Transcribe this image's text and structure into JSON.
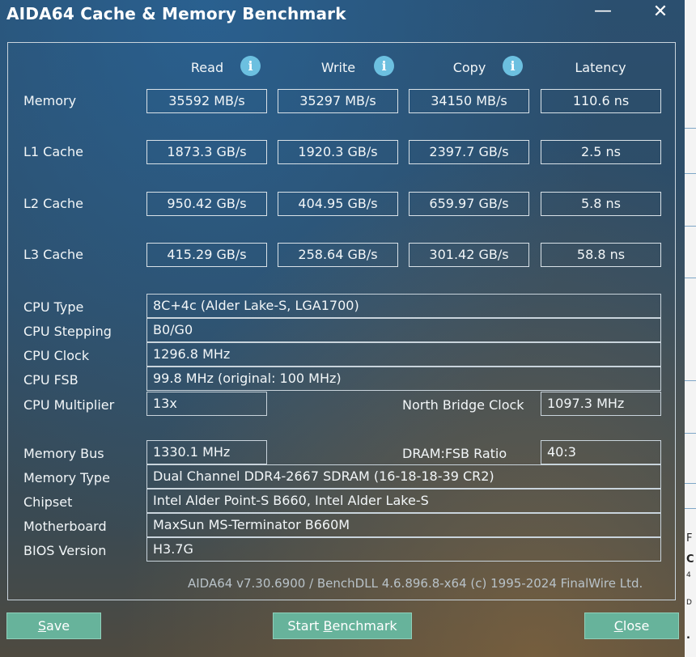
{
  "window": {
    "title": "AIDA64 Cache & Memory Benchmark",
    "minimize_glyph": "—",
    "close_glyph": "✕"
  },
  "columns": {
    "read": "Read",
    "write": "Write",
    "copy": "Copy",
    "latency": "Latency",
    "info_glyph": "i"
  },
  "bench_rows": [
    {
      "label": "Memory",
      "read": "35592 MB/s",
      "write": "35297 MB/s",
      "copy": "34150 MB/s",
      "latency": "110.6 ns"
    },
    {
      "label": "L1 Cache",
      "read": "1873.3 GB/s",
      "write": "1920.3 GB/s",
      "copy": "2397.7 GB/s",
      "latency": "2.5 ns"
    },
    {
      "label": "L2 Cache",
      "read": "950.42 GB/s",
      "write": "404.95 GB/s",
      "copy": "659.97 GB/s",
      "latency": "5.8 ns"
    },
    {
      "label": "L3 Cache",
      "read": "415.29 GB/s",
      "write": "258.64 GB/s",
      "copy": "301.42 GB/s",
      "latency": "58.8 ns"
    }
  ],
  "cpu": {
    "type_label": "CPU Type",
    "type_value": "8C+4c   (Alder Lake-S, LGA1700)",
    "stepping_label": "CPU Stepping",
    "stepping_value": "B0/G0",
    "clock_label": "CPU Clock",
    "clock_value": "1296.8 MHz",
    "fsb_label": "CPU FSB",
    "fsb_value": "99.8 MHz  (original: 100 MHz)",
    "multiplier_label": "CPU Multiplier",
    "multiplier_value": "13x",
    "nb_clock_label": "North Bridge Clock",
    "nb_clock_value": "1097.3 MHz"
  },
  "memory": {
    "bus_label": "Memory Bus",
    "bus_value": "1330.1 MHz",
    "ratio_label": "DRAM:FSB Ratio",
    "ratio_value": "40:3",
    "type_label": "Memory Type",
    "type_value": "Dual Channel DDR4-2667 SDRAM  (16-18-18-39 CR2)",
    "chipset_label": "Chipset",
    "chipset_value": "Intel Alder Point-S B660, Intel Alder Lake-S",
    "motherboard_label": "Motherboard",
    "motherboard_value": "MaxSun MS-Terminator B660M",
    "bios_label": "BIOS Version",
    "bios_value": "H3.7G"
  },
  "footer": "AIDA64 v7.30.6900 / BenchDLL 4.6.896.8-x64  (c) 1995-2024 FinalWire Ltd.",
  "buttons": {
    "save_key": "S",
    "save_rest": "ave",
    "start_pre": "Start ",
    "start_key": "B",
    "start_rest": "enchmark",
    "close_key": "C",
    "close_rest": "lose"
  },
  "background_fragments": [
    "F",
    "C",
    "4",
    "D",
    "."
  ]
}
